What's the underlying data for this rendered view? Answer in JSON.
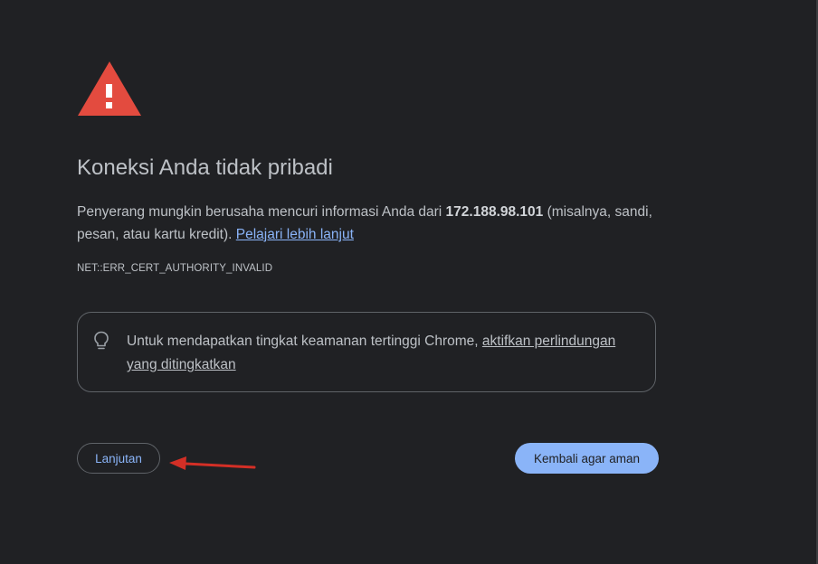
{
  "page": {
    "title": "Koneksi Anda tidak pribadi",
    "description": {
      "before": "Penyerang mungkin berusaha mencuri informasi Anda dari ",
      "host": "172.188.98.101",
      "after": " (misalnya, sandi, pesan, atau kartu kredit). ",
      "learn_more": "Pelajari lebih lanjut"
    },
    "error_code": "NET::ERR_CERT_AUTHORITY_INVALID"
  },
  "enhanced_protection": {
    "icon": "lightbulb-icon",
    "text": "Untuk mendapatkan tingkat keamanan tertinggi Chrome, ",
    "link": "aktifkan perlindungan yang ditingkatkan"
  },
  "buttons": {
    "advanced": "Lanjutan",
    "back_to_safety": "Kembali agar aman"
  },
  "icons": {
    "warning": "warning-triangle-icon",
    "annotation": "red-arrow-icon"
  },
  "colors": {
    "background": "#202124",
    "text": "#bdc1c6",
    "link": "#8ab4f8",
    "warning": "#e34b3f",
    "primary_button": "#8ab4f8",
    "annotation_arrow": "#d32f26"
  }
}
